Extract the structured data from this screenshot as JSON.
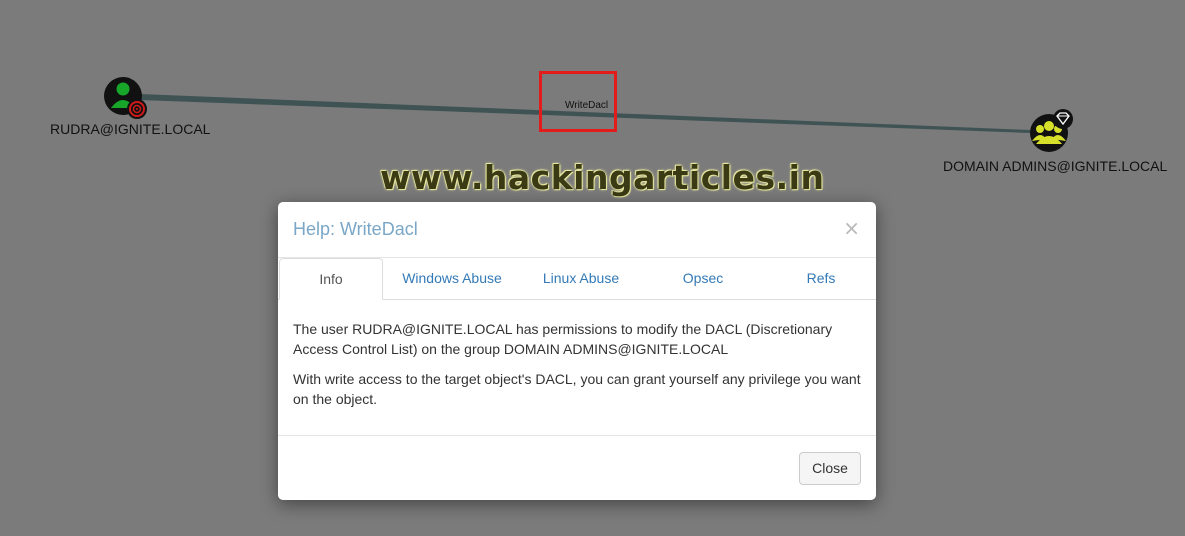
{
  "graph": {
    "source_node": {
      "label": "RUDRA@IGNITE.LOCAL",
      "icon": "user-icon",
      "badge": "target-icon"
    },
    "target_node": {
      "label": "DOMAIN ADMINS@IGNITE.LOCAL",
      "icon": "group-icon",
      "badge": "gem-icon"
    },
    "edge": {
      "label": "WriteDacl"
    }
  },
  "watermark": "www.hackingarticles.in",
  "modal": {
    "title": "Help: WriteDacl",
    "close_symbol": "×",
    "tabs": [
      {
        "label": "Info",
        "active": true
      },
      {
        "label": "Windows Abuse",
        "active": false
      },
      {
        "label": "Linux Abuse",
        "active": false
      },
      {
        "label": "Opsec",
        "active": false
      },
      {
        "label": "Refs",
        "active": false
      }
    ],
    "body": [
      "The user RUDRA@IGNITE.LOCAL has permissions to modify the DACL (Discretionary Access Control List) on the group DOMAIN ADMINS@IGNITE.LOCAL",
      "With write access to the target object's DACL, you can grant yourself any privilege you want on the object."
    ],
    "close_button": "Close"
  },
  "colors": {
    "background": "#7b7b7b",
    "user_node": "#17a52a",
    "group_node": "#d6e02a",
    "highlight": "#e31b1b",
    "title": "#7aa7c7",
    "link": "#337ab7"
  }
}
